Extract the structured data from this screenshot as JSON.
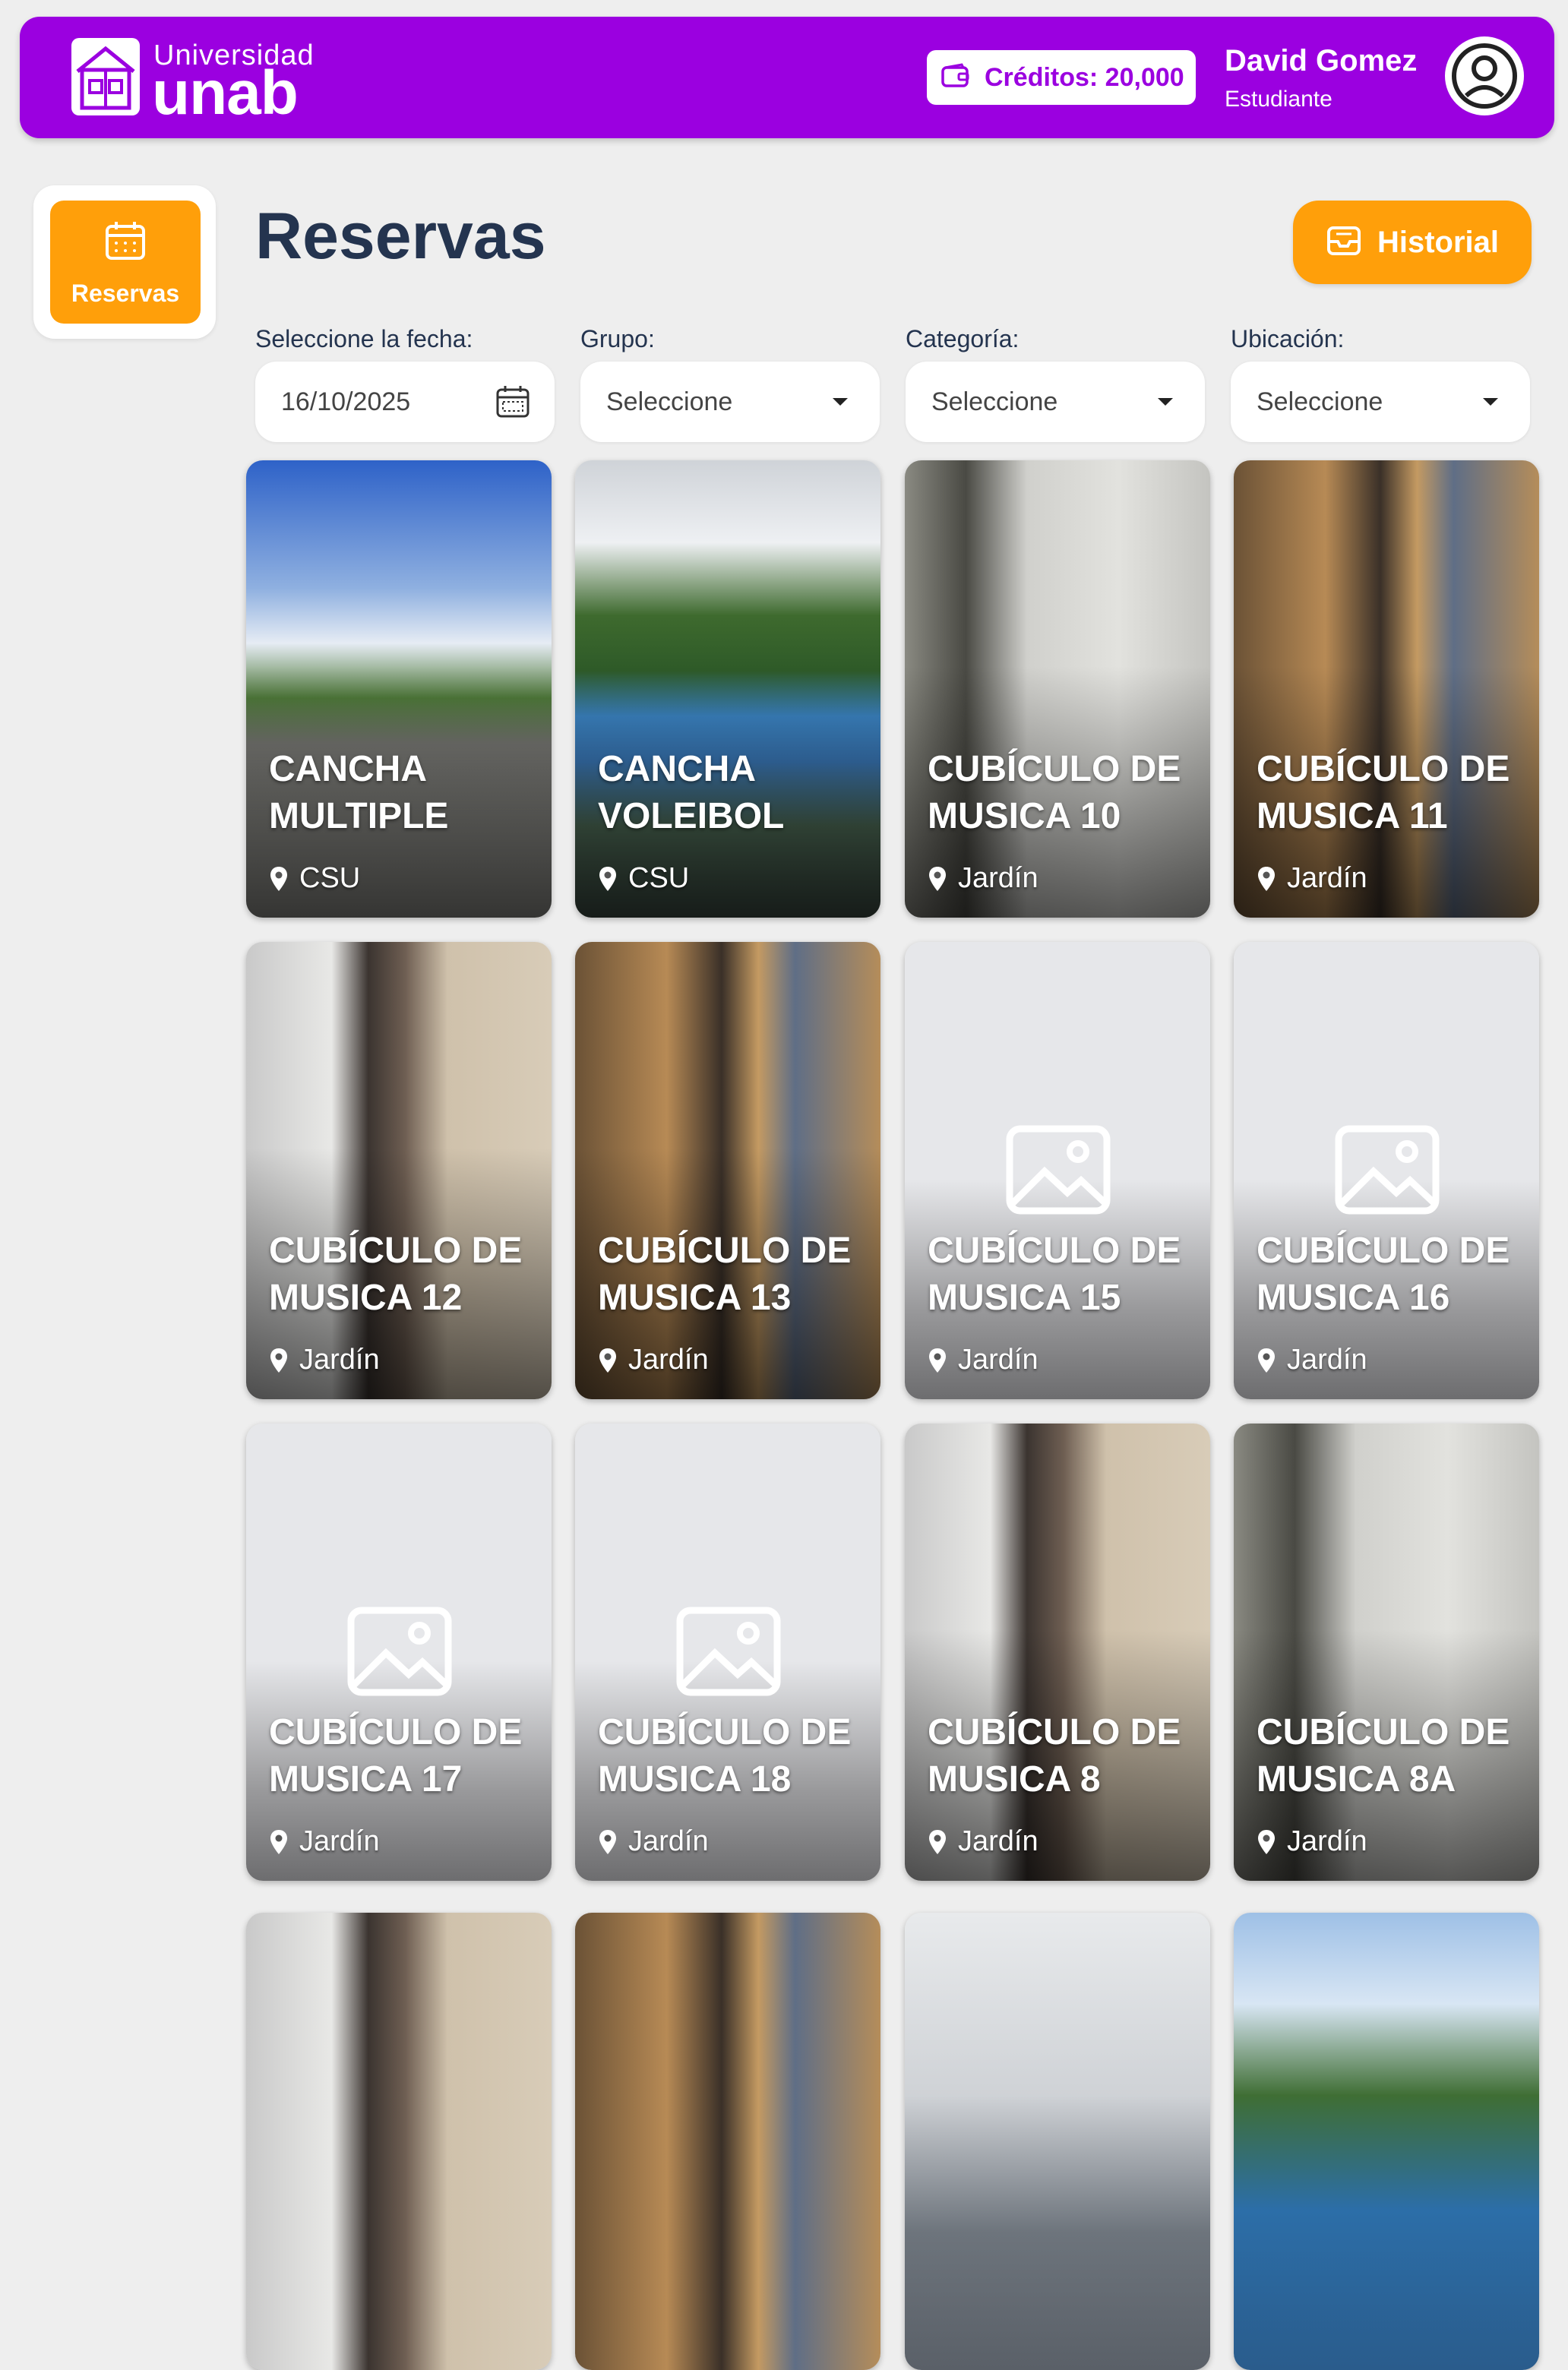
{
  "header": {
    "logo_small": "Universidad",
    "logo_big": "unab",
    "credits_label": "Créditos: 20,000",
    "user_name": "David Gomez",
    "user_role": "Estudiante",
    "brand_color": "#9b00e0"
  },
  "sidebar": {
    "items": [
      {
        "label": "Reservas",
        "icon": "calendar-icon",
        "active": true
      }
    ]
  },
  "main": {
    "title": "Reservas",
    "historial_label": "Historial",
    "accent_color": "#ff9f0a",
    "filters": {
      "fecha_label": "Seleccione la fecha:",
      "fecha_value": "16/10/2025",
      "grupo_label": "Grupo:",
      "grupo_value": "Seleccione",
      "categoria_label": "Categoría:",
      "categoria_value": "Seleccione",
      "ubicacion_label": "Ubicación:",
      "ubicacion_value": "Seleccione"
    },
    "cards": [
      {
        "name": "CANCHA MULTIPLE",
        "location": "CSU"
      },
      {
        "name": "CANCHA VOLEIBOL",
        "location": "CSU"
      },
      {
        "name": "CUBÍCULO DE MUSICA 10",
        "location": "Jardín"
      },
      {
        "name": "CUBÍCULO DE MUSICA 11",
        "location": "Jardín"
      },
      {
        "name": "CUBÍCULO DE MUSICA 12",
        "location": "Jardín"
      },
      {
        "name": "CUBÍCULO DE MUSICA 13",
        "location": "Jardín"
      },
      {
        "name": "CUBÍCULO DE MUSICA 15",
        "location": "Jardín"
      },
      {
        "name": "CUBÍCULO DE MUSICA 16",
        "location": "Jardín"
      },
      {
        "name": "CUBÍCULO DE MUSICA 17",
        "location": "Jardín"
      },
      {
        "name": "CUBÍCULO DE MUSICA 18",
        "location": "Jardín"
      },
      {
        "name": "CUBÍCULO DE MUSICA 8",
        "location": "Jardín"
      },
      {
        "name": "CUBÍCULO DE MUSICA 8A",
        "location": "Jardín"
      }
    ]
  }
}
